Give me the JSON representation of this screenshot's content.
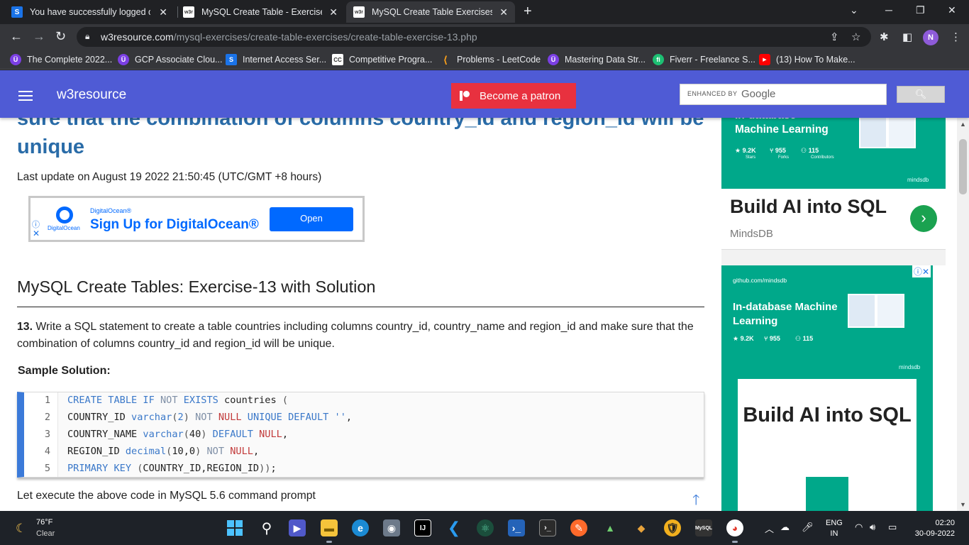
{
  "tabs": [
    {
      "title": "You have successfully logged on.",
      "icon": "S",
      "icon_color": "#1a73e8"
    },
    {
      "title": "MySQL Create Table - Exercises, P",
      "icon": "w3r",
      "icon_color": "#ffffff"
    },
    {
      "title": "MySQL Create Table Exercises: Cr",
      "icon": "w3r",
      "icon_color": "#ffffff"
    }
  ],
  "url": {
    "domain": "w3resource.com",
    "path": "/mysql-exercises/create-table-exercises/create-table-exercise-13.php"
  },
  "profile_initial": "N",
  "bookmarks": [
    {
      "label": "The Complete 2022...",
      "icon_color": "#7b3fe4"
    },
    {
      "label": "GCP Associate Clou...",
      "icon_color": "#7b3fe4"
    },
    {
      "label": "Internet Access Ser...",
      "icon_color": "#1a73e8"
    },
    {
      "label": "Competitive Progra...",
      "icon_color": "#ffffff"
    },
    {
      "label": "Problems - LeetCode",
      "icon_color": "#f89f1b"
    },
    {
      "label": "Mastering Data Str...",
      "icon_color": "#7b3fe4"
    },
    {
      "label": "Fiverr - Freelance S...",
      "icon_color": "#1dbf73"
    },
    {
      "label": "(13) How To Make...",
      "icon_color": "#ff0000"
    }
  ],
  "site": {
    "brand": "w3resource",
    "patron_label": "Become a patron",
    "search_label": "ENHANCED BY",
    "search_brand": "Google"
  },
  "article": {
    "title_partial": "sure that the combination of columns country_id and region_id will be unique",
    "updated": "Last update on August 19 2022 21:50:45 (UTC/GMT +8 hours)",
    "heading": "MySQL Create Tables: Exercise-13 with Solution",
    "question_number": "13.",
    "question_text": " Write a SQL statement to create a table countries including columns country_id, country_name and region_id and make sure that the combination of columns country_id and region_id will be unique.",
    "sample_label": "Sample Solution:",
    "code_line_numbers": [
      "1",
      "2",
      "3",
      "4",
      "5"
    ],
    "after_code": "Let execute the above code in MySQL 5.6 command prompt"
  },
  "ad_do": {
    "sponsor": "DigitalOcean®",
    "logo_text": "DigitalOcean",
    "headline": "Sign Up for DigitalOcean®",
    "button": "Open"
  },
  "ad_mindsdb": {
    "top_title": "In-database Machine Learning",
    "stars": "9.2K",
    "forks": "955",
    "contributors": "115",
    "stars_label": "Stars",
    "forks_label": "Forks",
    "contributors_label": "Contributors",
    "brand_small": "mindsdb",
    "card_title": "Build AI into SQL",
    "card_brand": "MindsDB",
    "gh_link_prefix": "github.com/",
    "gh_link_repo": "mindsdb",
    "bottom_title": "In-database Machine Learning",
    "bottom_card_title": "Build AI into SQL"
  },
  "taskbar": {
    "temp": "76°F",
    "condition": "Clear",
    "lang_top": "ENG",
    "lang_bottom": "IN",
    "time": "02:20",
    "date": "30-09-2022"
  }
}
